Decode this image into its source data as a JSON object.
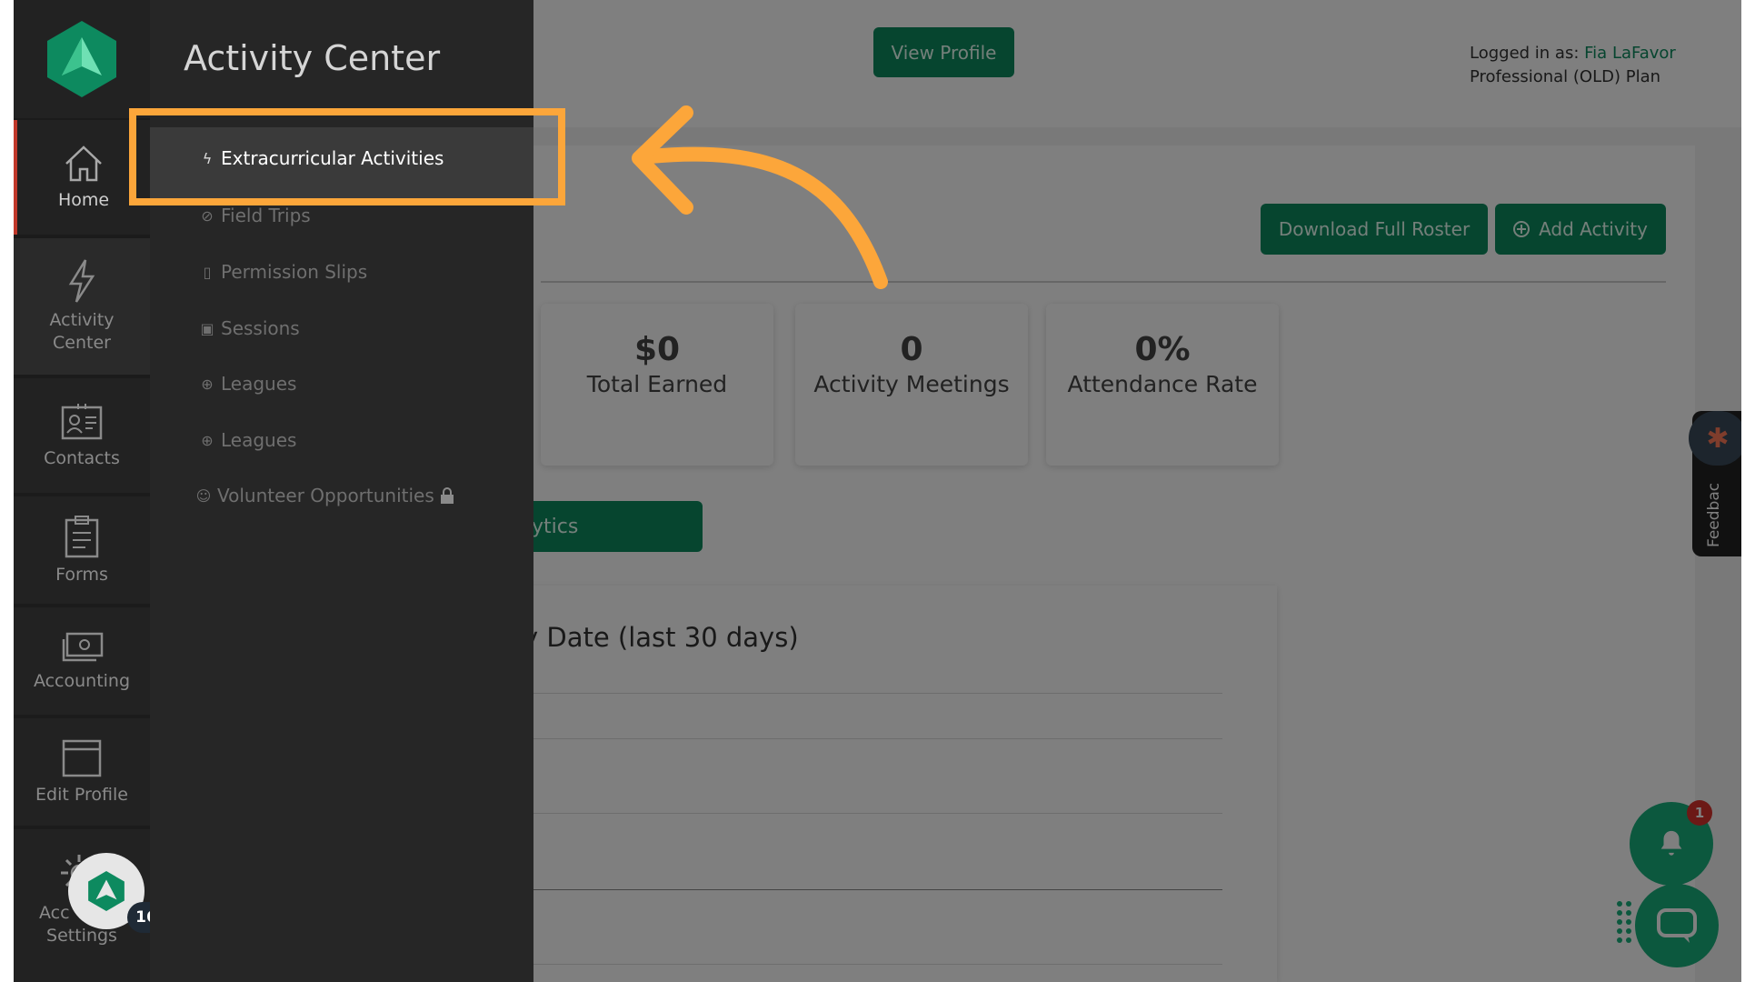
{
  "header": {
    "view_profile_label": "View Profile",
    "logged_in_prefix": "Logged in as:",
    "user_name": "Fia LaFavor",
    "plan": "Professional (OLD) Plan"
  },
  "actions": {
    "download_roster": "Download Full Roster",
    "add_activity": "Add Activity",
    "analytics": "ytics"
  },
  "stats": [
    {
      "value": "$0",
      "label": "Total Earned"
    },
    {
      "value": "0",
      "label": "Activity Meetings"
    },
    {
      "value": "0%",
      "label": "Attendance Rate"
    }
  ],
  "chart": {
    "title": "y Date (last 30 days)"
  },
  "rail": {
    "items": [
      {
        "label": "Home",
        "icon": "home-icon"
      },
      {
        "label": "Activity Center",
        "icon": "lightning-icon"
      },
      {
        "label": "Contacts",
        "icon": "contact-card-icon"
      },
      {
        "label": "Forms",
        "icon": "clipboard-icon"
      },
      {
        "label": "Accounting",
        "icon": "money-icon"
      },
      {
        "label": "Edit Profile",
        "icon": "window-icon"
      },
      {
        "label": "Acc Settings",
        "icon": "gear-icon"
      }
    ],
    "settings_line1": "Acc",
    "settings_line2": "Settings",
    "activity_line1": "Activity",
    "activity_line2": "Center",
    "fab_badge": "16"
  },
  "flyout": {
    "title": "Activity Center",
    "items": [
      {
        "label": "Extracurricular Activities",
        "icon": "lightning-icon"
      },
      {
        "label": "Field Trips",
        "icon": "compass-icon"
      },
      {
        "label": "Permission Slips",
        "icon": "document-icon"
      },
      {
        "label": "Sessions",
        "icon": "calendar-icon"
      },
      {
        "label": "Leagues",
        "icon": "ball-icon"
      },
      {
        "label": "Leagues",
        "icon": "ball-icon"
      },
      {
        "label": "Volunteer Opportunities",
        "icon": "smile-icon"
      }
    ]
  },
  "widgets": {
    "feedback_label": "Feedbac",
    "notification_count": "1"
  },
  "colors": {
    "accent": "#0d8a5f",
    "highlight": "#fca63a",
    "rail_bg": "#1b1b1b",
    "flyout_bg": "#262626"
  }
}
